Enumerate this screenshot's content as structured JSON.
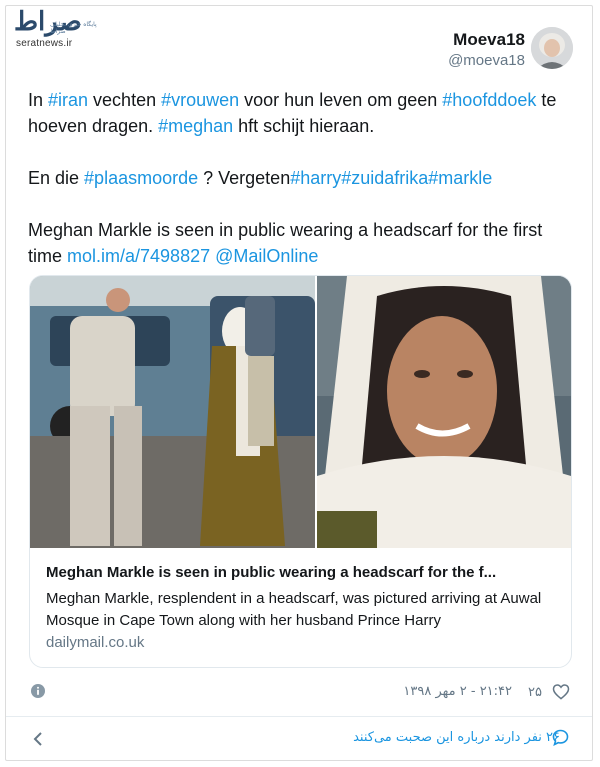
{
  "watermark": {
    "logo": "صراط",
    "tagline": "پایگاه خبری تحلیلی صراط",
    "url": "seratnews.ir"
  },
  "author": {
    "name": "Moeva18",
    "handle": "@moeva18"
  },
  "tweet": {
    "line1": [
      {
        "text": "In ",
        "tag": false
      },
      {
        "text": "#iran",
        "tag": true
      },
      {
        "text": " vechten ",
        "tag": false
      },
      {
        "text": "#vrouwen",
        "tag": true
      },
      {
        "text": " voor hun leven om geen ",
        "tag": false
      },
      {
        "text": "#hoofddoek",
        "tag": true
      },
      {
        "text": " te hoeven dragen. ",
        "tag": false
      },
      {
        "text": "#meghan",
        "tag": true
      },
      {
        "text": " hft schijt hieraan.",
        "tag": false
      }
    ],
    "line2": [
      {
        "text": "En die ",
        "tag": false
      },
      {
        "text": "#plaasmoorde",
        "tag": true
      },
      {
        "text": " ? Vergeten",
        "tag": false
      },
      {
        "text": "#harry",
        "tag": true
      },
      {
        "text": "#zuidafrika",
        "tag": true
      },
      {
        "text": "#markle",
        "tag": true
      }
    ],
    "line3": [
      {
        "text": "Meghan Markle is seen in public wearing a headscarf for the first time ",
        "tag": false
      },
      {
        "text": "mol.im/a/7498827",
        "tag": true
      },
      {
        "text": " ",
        "tag": false
      },
      {
        "text": "@MailOnline",
        "tag": true
      }
    ]
  },
  "link_card": {
    "title": "Meghan Markle is seen in public wearing a headscarf for the f...",
    "description": "Meghan Markle, resplendent in a headscarf, was pictured arriving at Auwal Mosque in Cape Town along with her husband Prince Harry",
    "domain": "dailymail.co.uk"
  },
  "footer": {
    "likes": "۲۵",
    "timestamp": "۲۱:۴۲ - ۲ مهر ۱۳۹۸",
    "people_talking": "۲۶ نفر دارند درباره این صحبت می‌کنند"
  },
  "colors": {
    "link": "#1b95e0",
    "muted": "#657786",
    "text": "#14171a",
    "border": "#e1e8ed"
  },
  "icons": [
    "info-icon",
    "heart-icon",
    "chevron-left-icon",
    "speech-bubble-icon"
  ]
}
